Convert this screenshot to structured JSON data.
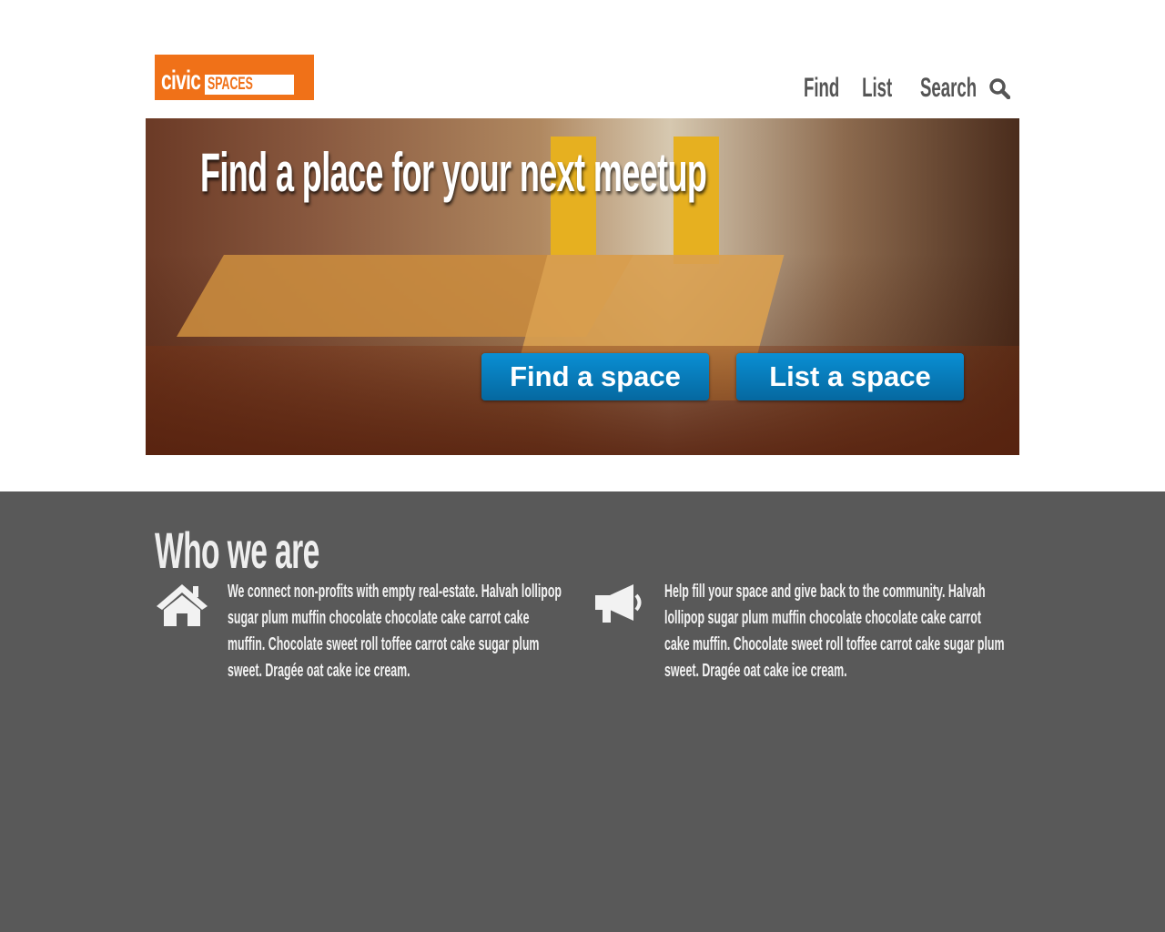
{
  "logo": {
    "civic": "civic",
    "spaces": "SPACES"
  },
  "nav": {
    "find": "Find",
    "list": "List",
    "search": "Search"
  },
  "hero": {
    "headline": "Find a place for your next meetup",
    "find_button": "Find a space",
    "list_button": "List a space"
  },
  "about": {
    "title": "Who we are",
    "left": "We connect non-profits with empty real-estate. Halvah lollipop sugar plum muffin chocolate chocolate cake carrot cake muffin. Chocolate sweet roll toffee carrot cake sugar plum sweet. Dragée oat cake ice cream.",
    "right": "Help fill your space and give back to the community. Halvah lollipop sugar plum muffin chocolate chocolate cake carrot cake muffin. Chocolate sweet roll toffee carrot cake sugar plum sweet. Dragée oat cake ice cream."
  },
  "colors": {
    "brand": "#f07118",
    "button": "#0a8fd4",
    "band": "#595959"
  }
}
